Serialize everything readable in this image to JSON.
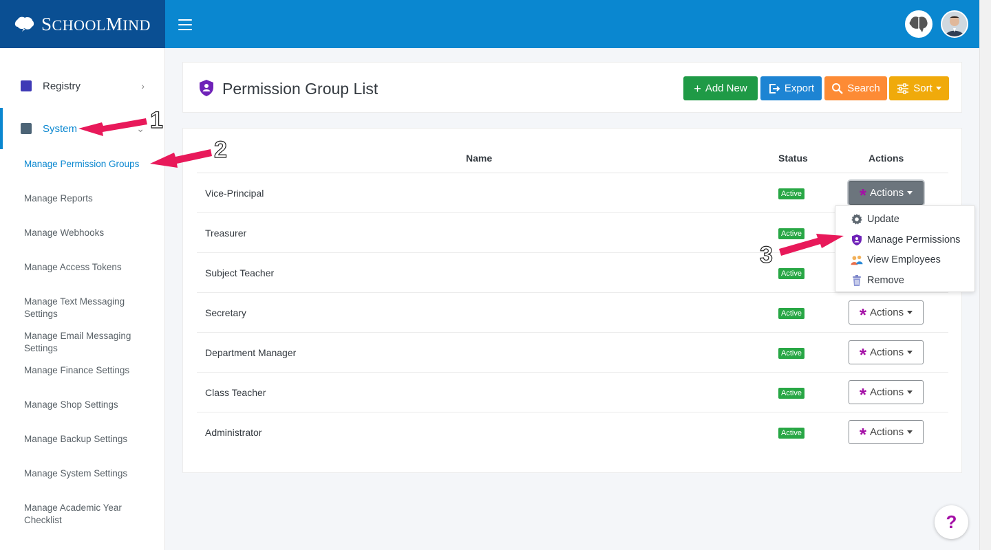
{
  "brand": {
    "name_first": "S",
    "name_rest": "CHOOL",
    "name_second": "M",
    "name_rest2": "IND"
  },
  "header": {
    "title": "Permission Group List"
  },
  "toolbar": {
    "add_label": "Add New",
    "export_label": "Export",
    "search_label": "Search",
    "sort_label": "Sort",
    "add_color": "#1f9a46",
    "export_color": "#1d84d3",
    "search_color": "#fd8b35",
    "sort_color": "#f0aa0b"
  },
  "sidebar": {
    "items": [
      {
        "label": "Registry",
        "icon": "registry-icon"
      },
      {
        "label": "System",
        "icon": "database-icon"
      }
    ],
    "subitems": [
      "Manage Permission Groups",
      "Manage Reports",
      "Manage Webhooks",
      "Manage Access Tokens",
      "Manage Text Messaging Settings",
      "Manage Email Messaging Settings",
      "Manage Finance Settings",
      "Manage Shop Settings",
      "Manage Backup Settings",
      "Manage System Settings",
      "Manage Academic Year Checklist"
    ]
  },
  "table": {
    "columns": [
      "Name",
      "Status",
      "Actions"
    ],
    "rows": [
      {
        "name": "Vice-Principal",
        "status": "Active",
        "action": "Actions"
      },
      {
        "name": "Treasurer",
        "status": "Active",
        "action": "Actions"
      },
      {
        "name": "Subject Teacher",
        "status": "Active",
        "action": "Actions"
      },
      {
        "name": "Secretary",
        "status": "Active",
        "action": "Actions"
      },
      {
        "name": "Department Manager",
        "status": "Active",
        "action": "Actions"
      },
      {
        "name": "Class Teacher",
        "status": "Active",
        "action": "Actions"
      },
      {
        "name": "Administrator",
        "status": "Active",
        "action": "Actions"
      }
    ]
  },
  "dropdown": {
    "items": [
      {
        "label": "Update",
        "icon": "gear-icon"
      },
      {
        "label": "Manage Permissions",
        "icon": "shield-user-icon"
      },
      {
        "label": "View Employees",
        "icon": "people-icon"
      },
      {
        "label": "Remove",
        "icon": "trash-icon"
      }
    ]
  },
  "annotations": [
    "1",
    "2",
    "3"
  ],
  "help": {
    "label": "?"
  }
}
